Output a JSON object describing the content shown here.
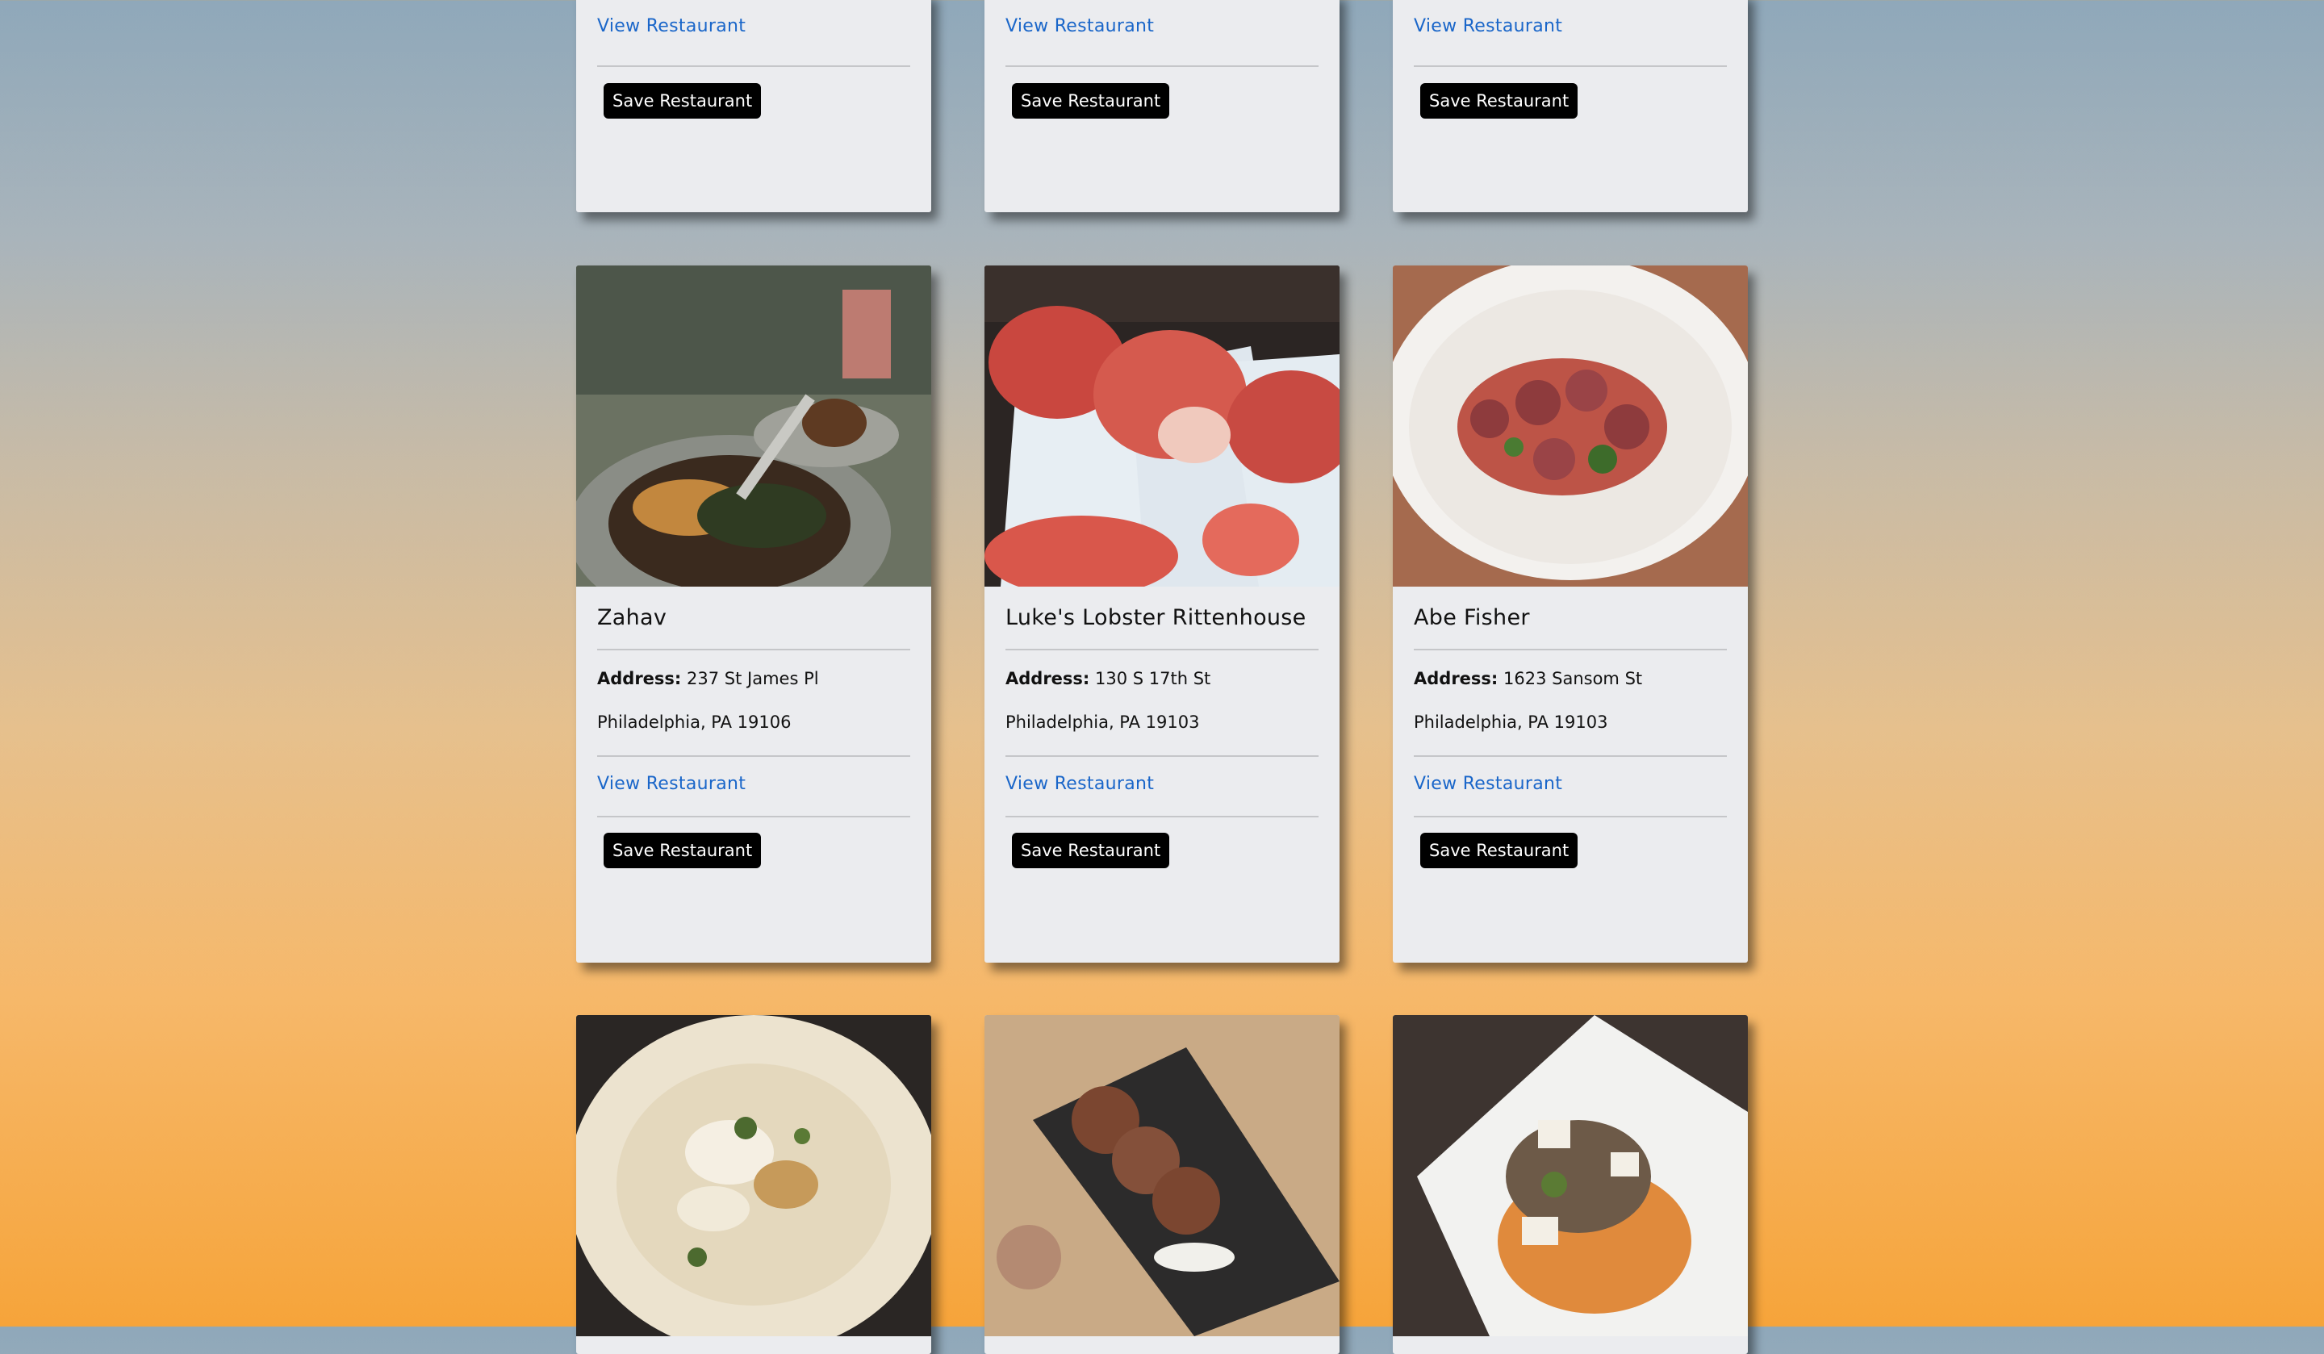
{
  "top_row": [
    {
      "view_label": "View Restaurant",
      "save_label": "Save Restaurant"
    },
    {
      "view_label": "View Restaurant",
      "save_label": "Save Restaurant"
    },
    {
      "view_label": "View Restaurant",
      "save_label": "Save Restaurant"
    }
  ],
  "middle_row": [
    {
      "name": "Zahav",
      "address_label": "Address:",
      "street": "237 St James Pl",
      "city": "Philadelphia, PA 19106",
      "view_label": "View Restaurant",
      "save_label": "Save Restaurant"
    },
    {
      "name": "Luke's Lobster Rittenhouse",
      "address_label": "Address:",
      "street": "130 S 17th St",
      "city": "Philadelphia, PA 19103",
      "view_label": "View Restaurant",
      "save_label": "Save Restaurant"
    },
    {
      "name": "Abe Fisher",
      "address_label": "Address:",
      "street": "1623 Sansom St",
      "city": "Philadelphia, PA 19103",
      "view_label": "View Restaurant",
      "save_label": "Save Restaurant"
    }
  ],
  "colors": {
    "link": "#1a66c9",
    "card": "#ebecef",
    "button": "#000000"
  }
}
